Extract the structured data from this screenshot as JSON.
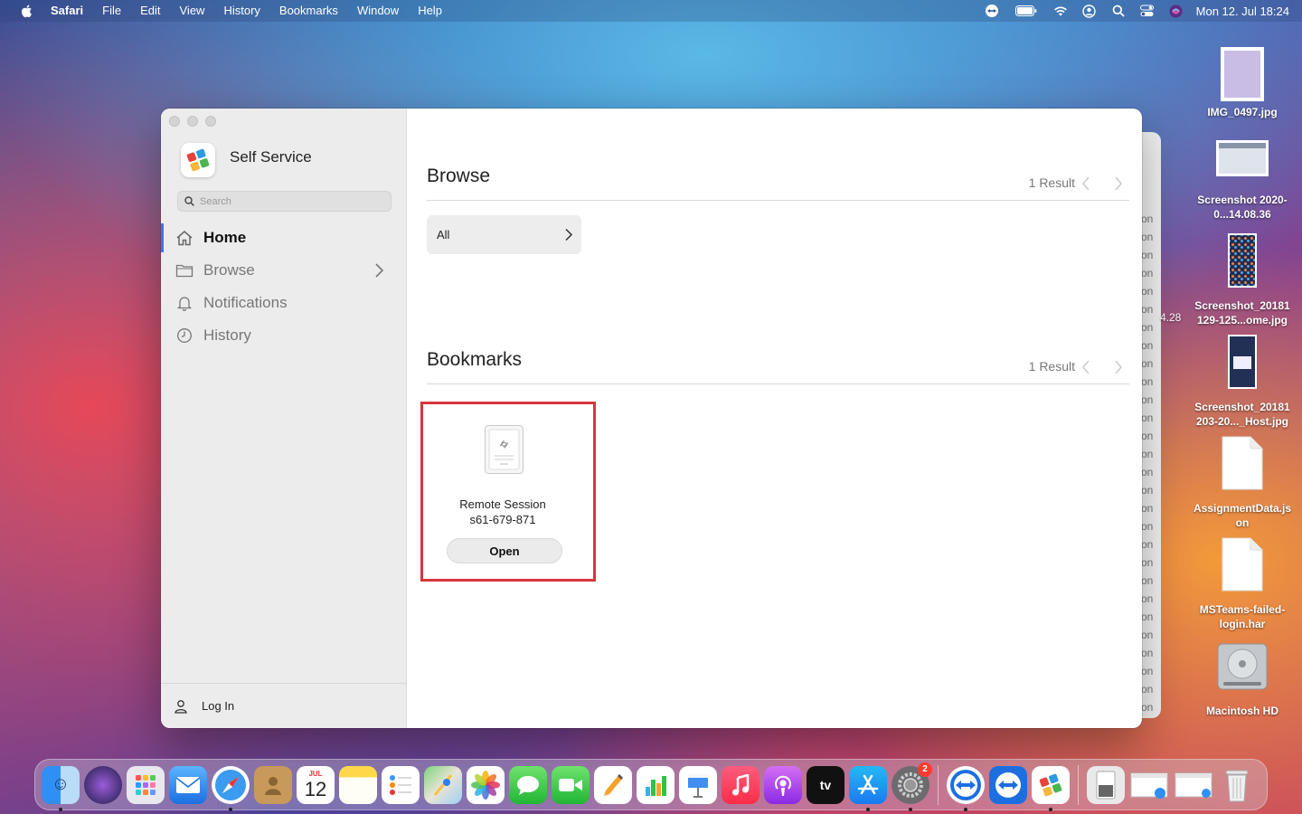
{
  "menubar": {
    "app_name": "Safari",
    "items": [
      "File",
      "Edit",
      "View",
      "History",
      "Bookmarks",
      "Window",
      "Help"
    ],
    "clock": "Mon 12. Jul  18:24"
  },
  "background_window": {
    "rows": [
      "on",
      "on",
      "on",
      "on",
      "on",
      "on",
      "on",
      "on",
      "on",
      "on",
      "on",
      "on",
      "on",
      "on",
      "on",
      "on",
      "on",
      "on",
      "on",
      "on",
      "on",
      "on",
      "on",
      "on",
      "on",
      "on",
      "on",
      "on"
    ],
    "fragment": "4.28"
  },
  "sidebar": {
    "app_title": "Self Service",
    "search_placeholder": "Search",
    "nav": [
      {
        "label": "Home",
        "active": true,
        "icon": "home-icon"
      },
      {
        "label": "Browse",
        "active": false,
        "icon": "folder-icon"
      },
      {
        "label": "Notifications",
        "active": false,
        "icon": "bell-icon"
      },
      {
        "label": "History",
        "active": false,
        "icon": "clock-icon"
      }
    ],
    "login_label": "Log In"
  },
  "browse": {
    "title": "Browse",
    "result_count": "1 Result",
    "category": "All"
  },
  "bookmarks": {
    "title": "Bookmarks",
    "result_count": "1 Result",
    "card": {
      "title": "Remote Session",
      "subtitle": "s61-679-871",
      "button": "Open"
    }
  },
  "desktop": {
    "icons": [
      {
        "label": "IMG_0497.jpg"
      },
      {
        "label": "Screenshot 2020-0...14.08.36"
      },
      {
        "label": "Screenshot_20181 129-125...ome.jpg"
      },
      {
        "label": "Screenshot_20181 203-20..._Host.jpg"
      },
      {
        "label": "AssignmentData.js on"
      },
      {
        "label": "MSTeams-failed-login.har"
      },
      {
        "label": "Macintosh HD"
      }
    ]
  },
  "dock": {
    "calendar_month": "JUL",
    "calendar_day": "12",
    "tv_label": "tv",
    "settings_badge": "2"
  },
  "colors": {
    "accent": "#3478f6",
    "highlight": "#d6363d"
  }
}
